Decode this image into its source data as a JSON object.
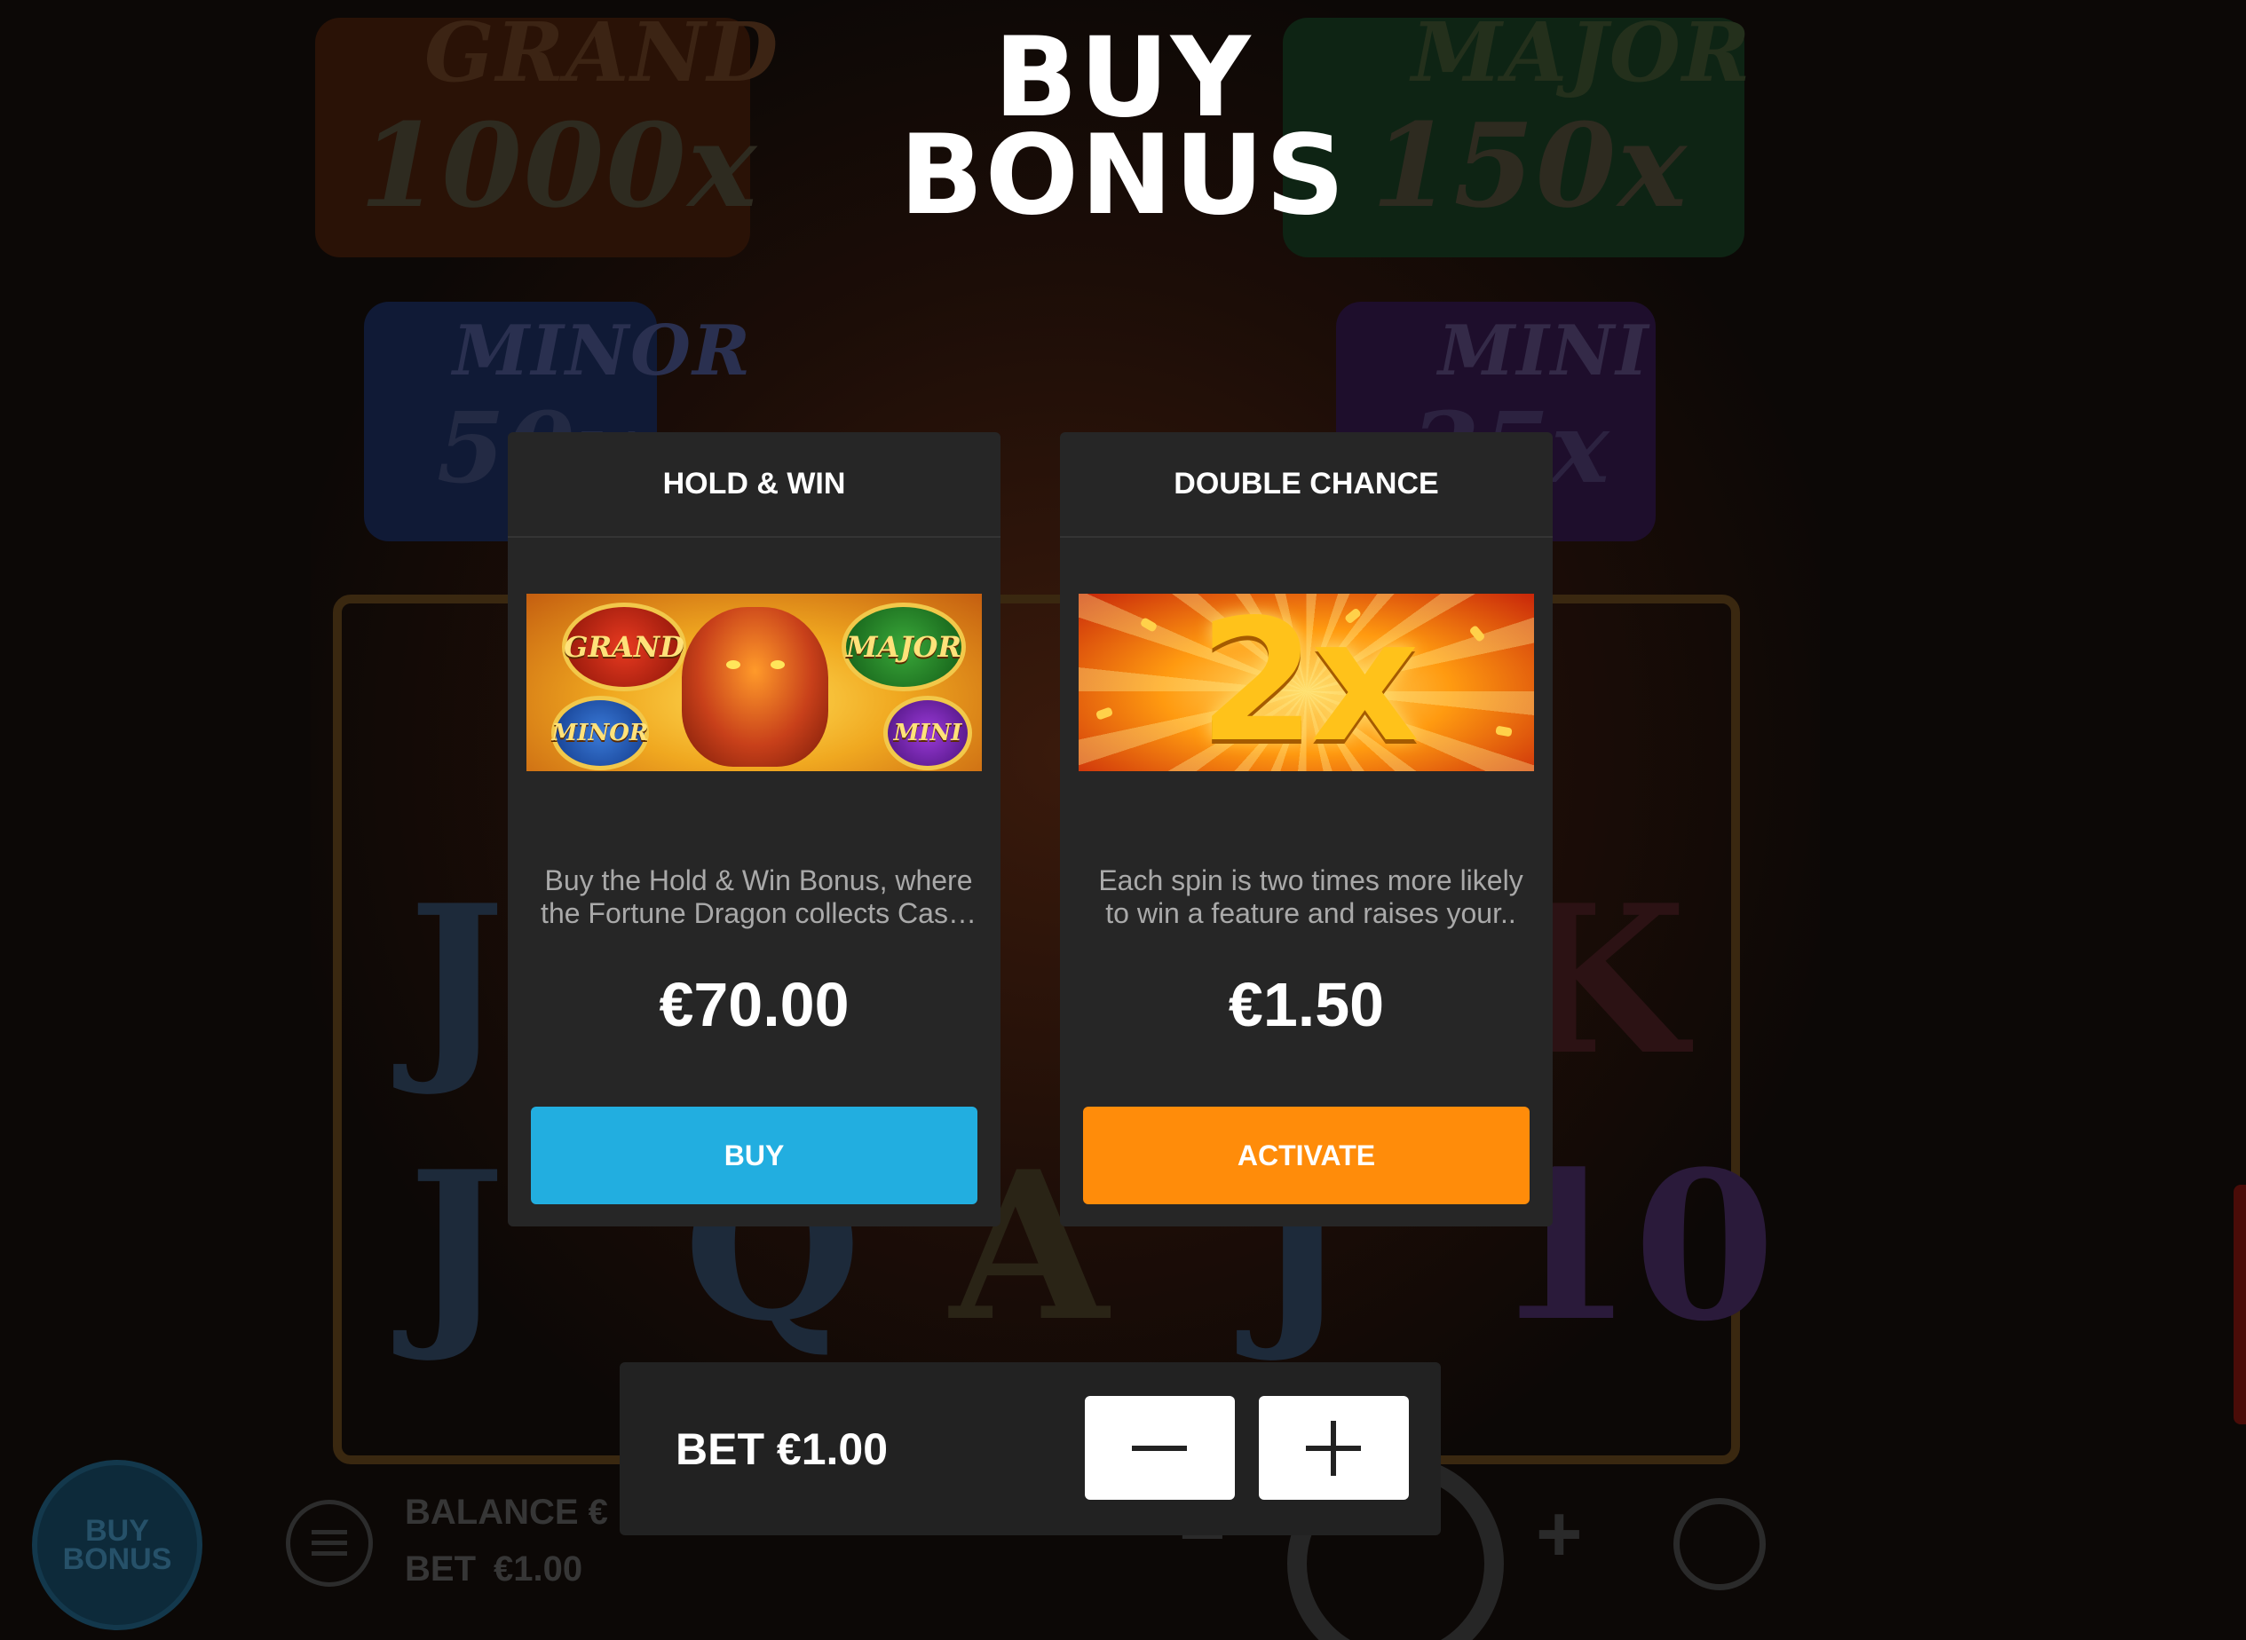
{
  "title": {
    "line1": "BUY",
    "line2": "BONUS"
  },
  "background": {
    "jackpots": [
      {
        "name": "GRAND",
        "value": "1000x"
      },
      {
        "name": "MAJOR",
        "value": "150x"
      },
      {
        "name": "MINOR",
        "value": "50x"
      },
      {
        "name": "MINI",
        "value": "25x"
      }
    ],
    "reel_symbols": [
      "J",
      "Q",
      "A",
      "K",
      "10"
    ],
    "game_bar": {
      "buy_bonus_label": "BUY BONUS",
      "balance_label": "BALANCE €",
      "bet_label": "BET",
      "bet_value": "€1.00",
      "minus": "−",
      "plus": "+"
    }
  },
  "cards": [
    {
      "title": "HOLD & WIN",
      "image": {
        "coins": [
          "GRAND",
          "MAJOR",
          "MINOR",
          "MINI"
        ]
      },
      "description_line1": "Buy the Hold & Win Bonus, where",
      "description_line2": "the Fortune Dragon collects Cas…",
      "price": "€70.00",
      "button": "BUY",
      "button_color": "#22aee0"
    },
    {
      "title": "DOUBLE CHANCE",
      "image": {
        "text": "2x"
      },
      "description_line1": "Each spin is two times more likely",
      "description_line2": "to win a feature and raises your..",
      "price": "€1.50",
      "button": "ACTIVATE",
      "button_color": "#ff8c0a"
    }
  ],
  "bet_panel": {
    "label": "BET €1.00",
    "decrease_icon": "minus-icon",
    "increase_icon": "plus-icon"
  }
}
